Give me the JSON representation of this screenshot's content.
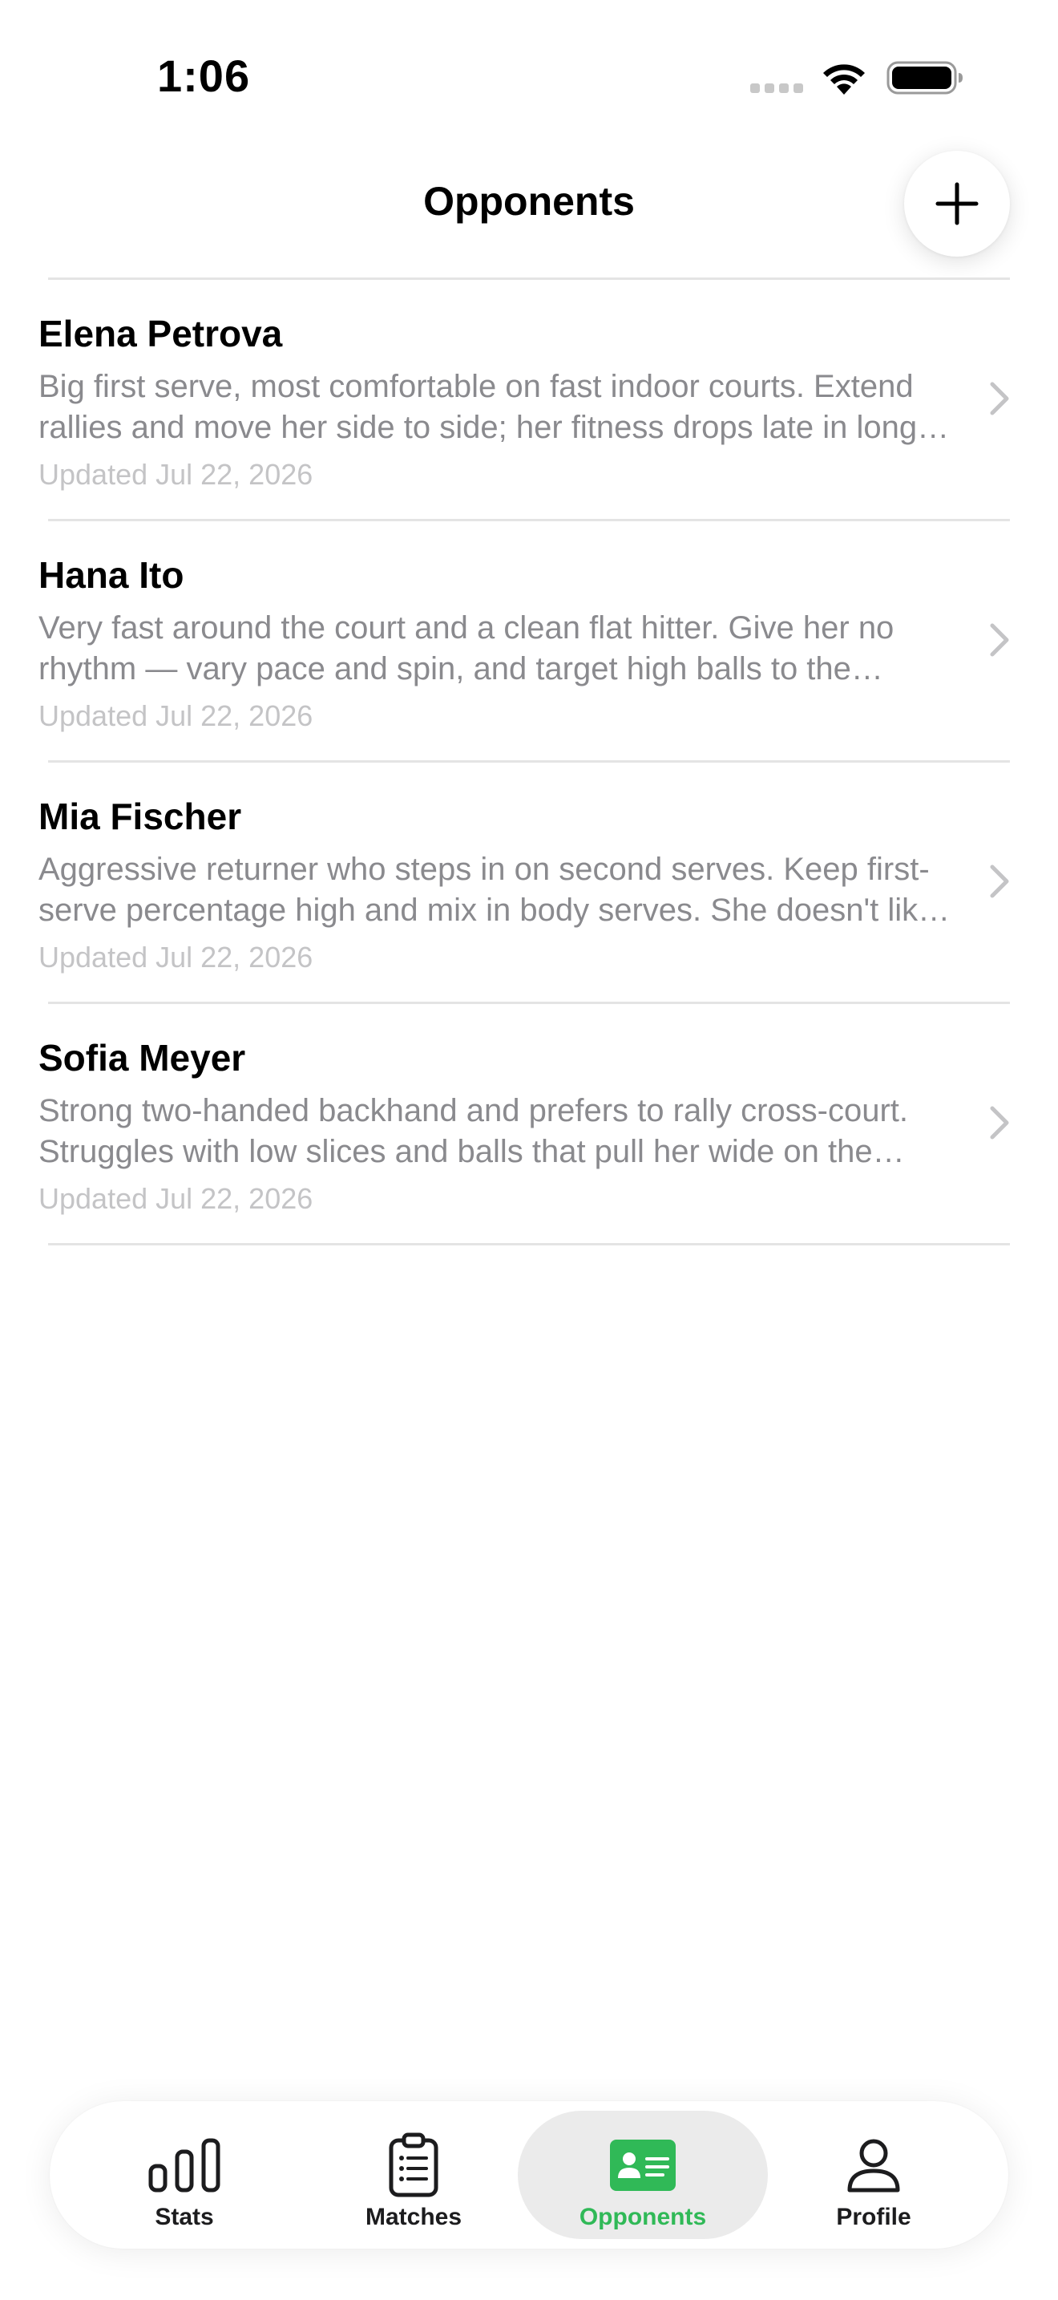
{
  "status_bar": {
    "time": "1:06"
  },
  "header": {
    "title": "Opponents",
    "add_icon": "plus-icon"
  },
  "opponents": [
    {
      "name": "Elena Petrova",
      "notes": "Big first serve, most comfortable on fast indoor courts. Extend rallies and move her side to side; her fitness drops late in long matches.",
      "updated": "Updated Jul 22, 2026"
    },
    {
      "name": "Hana Ito",
      "notes": "Very fast around the court and a clean flat hitter. Give her no rhythm — vary pace and spin, and target high balls to the backhand.",
      "updated": "Updated Jul 22, 2026"
    },
    {
      "name": "Mia Fischer",
      "notes": "Aggressive returner who steps in on second serves. Keep first-serve percentage high and mix in body serves. She doesn't like to defend.",
      "updated": "Updated Jul 22, 2026"
    },
    {
      "name": "Sofia Meyer",
      "notes": "Strong two-handed backhand and prefers to rally cross-court. Struggles with low slices and balls that pull her wide on the forehand.",
      "updated": "Updated Jul 22, 2026"
    }
  ],
  "tab_bar": {
    "tabs": [
      {
        "label": "Stats",
        "icon": "bar-chart-icon",
        "active": false
      },
      {
        "label": "Matches",
        "icon": "clipboard-list-icon",
        "active": false
      },
      {
        "label": "Opponents",
        "icon": "contact-card-icon",
        "active": true
      },
      {
        "label": "Profile",
        "icon": "person-icon",
        "active": false
      }
    ]
  },
  "colors": {
    "accent": "#30b957",
    "secondary_text": "#8a8a8e",
    "tertiary_text": "#c4c4c6",
    "divider": "#e4e4e4",
    "active_tab_bg": "#ebebeb"
  }
}
